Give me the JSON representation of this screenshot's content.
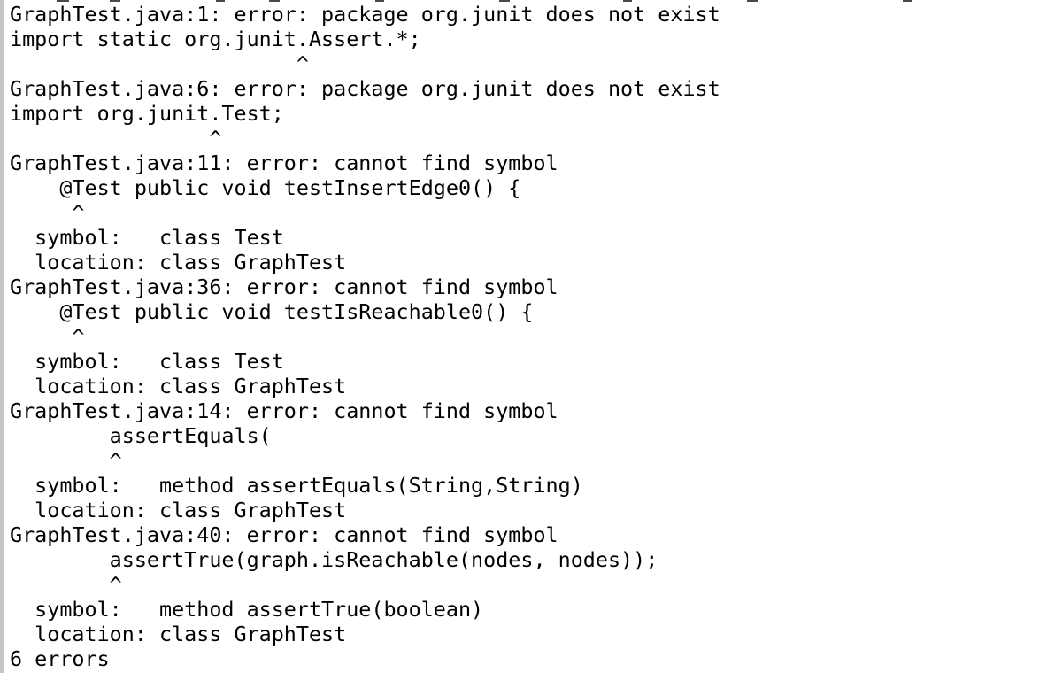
{
  "terminal": {
    "lines": [
      "GraphTest.java:1: error: package org.junit does not exist",
      "import static org.junit.Assert.*;",
      "                       ^",
      "GraphTest.java:6: error: package org.junit does not exist",
      "import org.junit.Test;",
      "                ^",
      "GraphTest.java:11: error: cannot find symbol",
      "    @Test public void testInsertEdge0() {",
      "     ^",
      "  symbol:   class Test",
      "  location: class GraphTest",
      "GraphTest.java:36: error: cannot find symbol",
      "    @Test public void testIsReachable0() {",
      "     ^",
      "  symbol:   class Test",
      "  location: class GraphTest",
      "GraphTest.java:14: error: cannot find symbol",
      "        assertEquals(",
      "        ^",
      "  symbol:   method assertEquals(String,String)",
      "  location: class GraphTest",
      "GraphTest.java:40: error: cannot find symbol",
      "        assertTrue(graph.isReachable(nodes, nodes));",
      "        ^",
      "  symbol:   method assertTrue(boolean)",
      "  location: class GraphTest",
      "6 errors"
    ]
  },
  "colors": {
    "background": "#ffffff",
    "text": "#000000",
    "left_border": "#c4c4c4"
  }
}
